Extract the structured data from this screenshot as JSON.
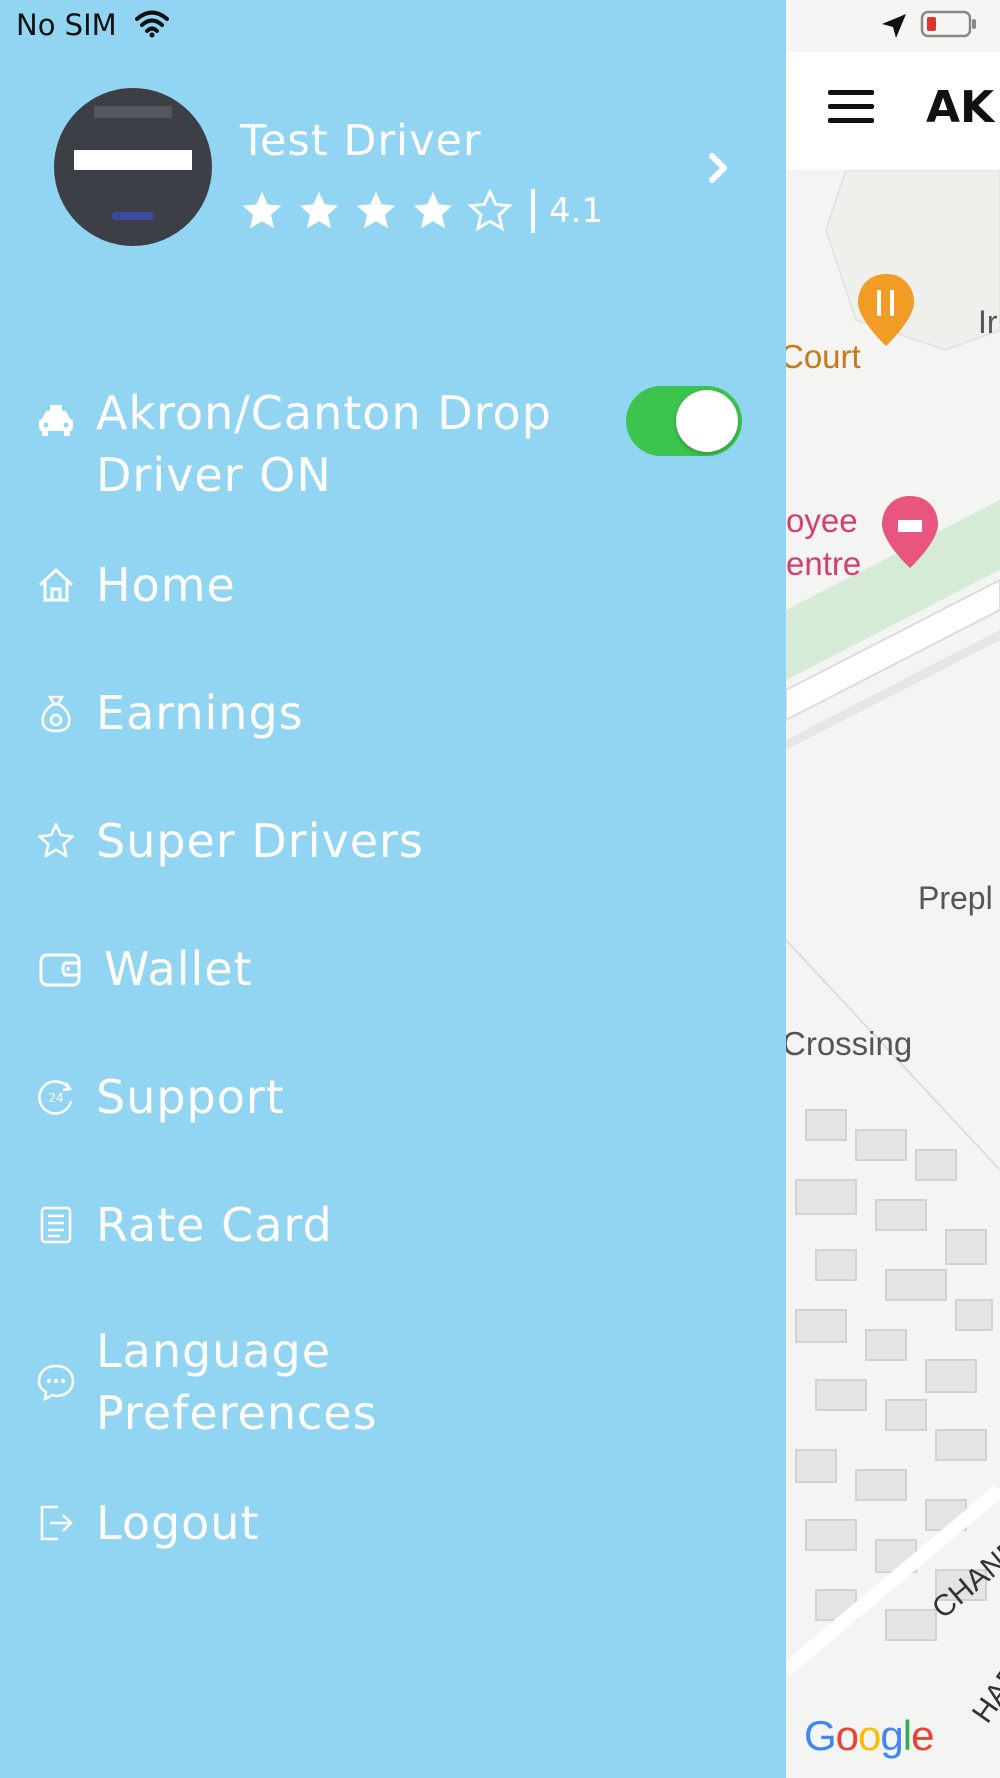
{
  "status_bar": {
    "carrier": "No SIM"
  },
  "map": {
    "title": "AK",
    "labels": {
      "court": "Court",
      "in": "Ir",
      "oyee": "oyee",
      "entre": "entre",
      "prepl": "Prepl",
      "crossing": "Crossing",
      "road1": "CHANDIGA",
      "road2": "HAR"
    },
    "attribution": "Google"
  },
  "profile": {
    "name": "Test Driver",
    "rating": "4.1",
    "stars_filled": 4,
    "stars_total": 5
  },
  "menu": {
    "driver_status": {
      "label": "Akron/Canton Drop Driver ON",
      "toggle_on": true,
      "icon": "car-icon"
    },
    "items": [
      {
        "label": "Home",
        "icon": "home-icon"
      },
      {
        "label": "Earnings",
        "icon": "money-bag-icon"
      },
      {
        "label": "Super Drivers",
        "icon": "star-icon"
      },
      {
        "label": "Wallet",
        "icon": "wallet-icon"
      },
      {
        "label": "Support",
        "icon": "support-24-icon"
      },
      {
        "label": "Rate Card",
        "icon": "document-icon"
      },
      {
        "label": "Language Preferences",
        "icon": "chat-bubble-icon"
      },
      {
        "label": "Logout",
        "icon": "logout-icon"
      }
    ]
  },
  "colors": {
    "drawer_bg": "#92d5f3",
    "toggle_on": "#3bc54f",
    "text": "#ffffff"
  }
}
